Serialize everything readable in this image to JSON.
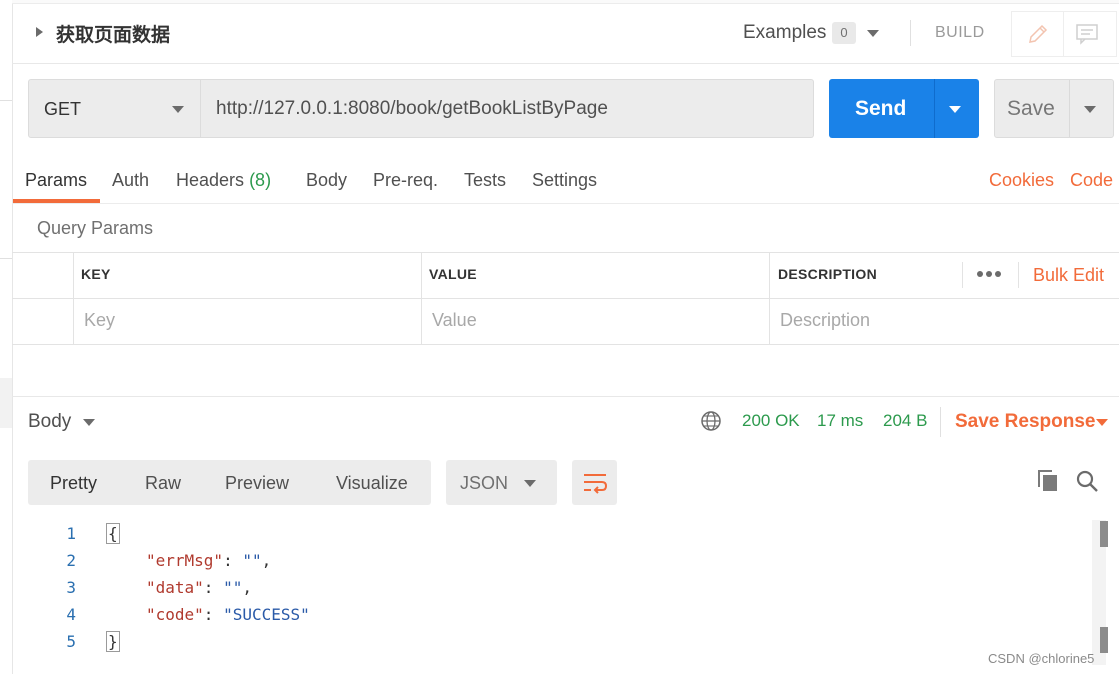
{
  "request": {
    "title": "获取页面数据",
    "examples_label": "Examples",
    "examples_count": "0",
    "build_label": "BUILD",
    "method": "GET",
    "url": "http://127.0.0.1:8080/book/getBookListByPage",
    "send_label": "Send",
    "save_label": "Save"
  },
  "tabs": {
    "params": "Params",
    "auth": "Auth",
    "headers": "Headers",
    "headers_count": "(8)",
    "body": "Body",
    "prereq": "Pre-req.",
    "tests": "Tests",
    "settings": "Settings",
    "cookies": "Cookies",
    "code": "Code",
    "active": "Params"
  },
  "params": {
    "section_label": "Query Params",
    "columns": [
      "KEY",
      "VALUE",
      "DESCRIPTION"
    ],
    "bulk_edit": "Bulk Edit",
    "placeholders": {
      "key": "Key",
      "value": "Value",
      "description": "Description"
    }
  },
  "response": {
    "body_label": "Body",
    "status": "200 OK",
    "time": "17 ms",
    "size": "204 B",
    "save_response": "Save Response",
    "views": [
      "Pretty",
      "Raw",
      "Preview",
      "Visualize"
    ],
    "format": "JSON",
    "code_lines": [
      {
        "n": "1",
        "text": "{"
      },
      {
        "n": "2",
        "key": "\"errMsg\"",
        "value": "\"\""
      },
      {
        "n": "3",
        "key": "\"data\"",
        "value": "\"\""
      },
      {
        "n": "4",
        "key": "\"code\"",
        "value": "\"SUCCESS\""
      },
      {
        "n": "5",
        "text": "}"
      }
    ]
  },
  "watermark": "CSDN @chlorine5",
  "colors": {
    "accent_orange": "#f26b3a",
    "send_blue": "#1a82e8",
    "status_green": "#2c9a4d"
  },
  "icons": [
    "caret-right-icon",
    "chevron-down-icon",
    "edit-pencil-icon",
    "comment-icon",
    "more-dots-icon",
    "globe-icon",
    "wrap-lines-icon",
    "copy-icon",
    "search-icon"
  ]
}
